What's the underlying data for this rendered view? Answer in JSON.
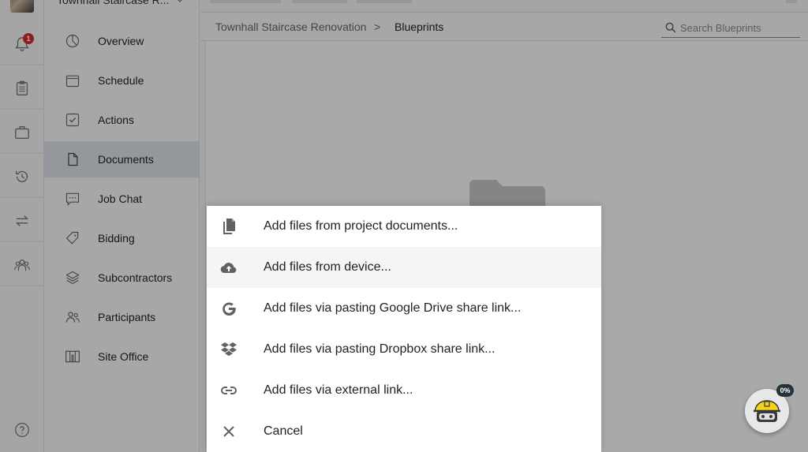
{
  "project": {
    "name": "Townhall Staircase R..."
  },
  "rail": {
    "notification_count": "1"
  },
  "sidebar": {
    "items": [
      {
        "label": "Overview"
      },
      {
        "label": "Schedule"
      },
      {
        "label": "Actions"
      },
      {
        "label": "Documents"
      },
      {
        "label": "Job Chat"
      },
      {
        "label": "Bidding"
      },
      {
        "label": "Subcontractors"
      },
      {
        "label": "Participants"
      },
      {
        "label": "Site Office"
      }
    ],
    "active": "Documents"
  },
  "breadcrumb": {
    "project": "Townhall Staircase Renovation",
    "separator": ">",
    "current": "Blueprints"
  },
  "search": {
    "placeholder": "Search Blueprints"
  },
  "sheet": {
    "items": [
      {
        "label": "Add files from project documents...",
        "icon": "documents-copy-icon"
      },
      {
        "label": "Add files from device...",
        "icon": "cloud-upload-icon"
      },
      {
        "label": "Add files via pasting Google Drive share link...",
        "icon": "google-icon"
      },
      {
        "label": "Add files via pasting Dropbox share link...",
        "icon": "dropbox-icon"
      },
      {
        "label": "Add files via external link...",
        "icon": "link-icon"
      },
      {
        "label": "Cancel",
        "icon": "close-icon"
      }
    ]
  },
  "helper": {
    "progress": "0%"
  },
  "colors": {
    "badge": "#d32f2f",
    "active_nav": "#dbe1e6",
    "bot_hat": "#f2d21b"
  }
}
